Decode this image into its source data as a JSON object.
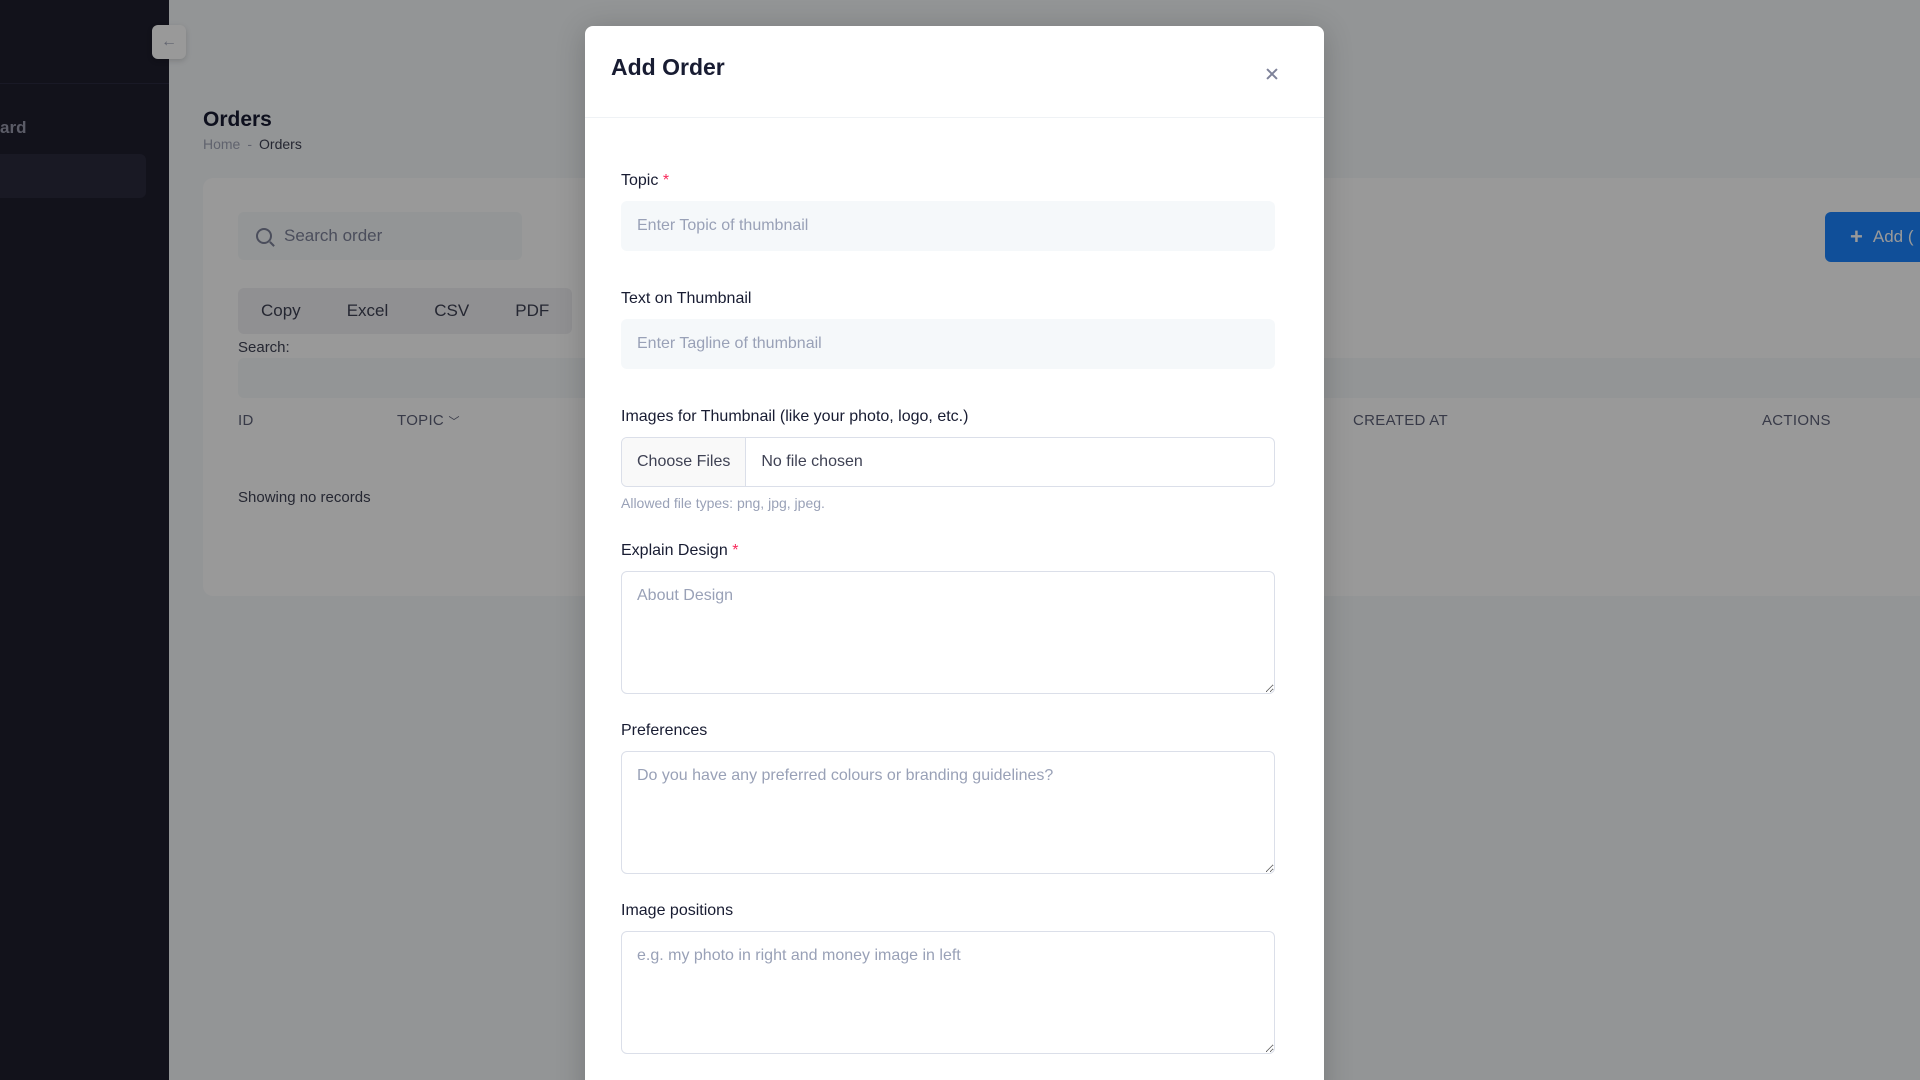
{
  "sidebar": {
    "item_label": "ard"
  },
  "page": {
    "title": "Orders",
    "breadcrumb": {
      "home": "Home",
      "separator": "-",
      "current": "Orders"
    }
  },
  "toolbar": {
    "search_placeholder": "Search order",
    "add_label": "Add ("
  },
  "exports": [
    "Copy",
    "Excel",
    "CSV",
    "PDF"
  ],
  "datatable": {
    "search_label": "Search:",
    "columns": {
      "id": "ID",
      "topic": "TOPIC",
      "created_at": "CREATED AT",
      "actions": "ACTIONS"
    },
    "empty_text": "Showing no records"
  },
  "modal": {
    "title": "Add Order",
    "topic": {
      "label": "Topic",
      "required": "*",
      "placeholder": "Enter Topic of thumbnail"
    },
    "text_on_thumbnail": {
      "label": "Text on Thumbnail",
      "placeholder": "Enter Tagline of thumbnail"
    },
    "images": {
      "label": "Images for Thumbnail (like your photo, logo, etc.)",
      "button": "Choose Files",
      "status": "No file chosen",
      "help": "Allowed file types: png, jpg, jpeg."
    },
    "explain_design": {
      "label": "Explain Design",
      "required": "*",
      "placeholder": "About Design"
    },
    "preferences": {
      "label": "Preferences",
      "placeholder": "Do you have any preferred colours or branding guidelines?"
    },
    "image_positions": {
      "label": "Image positions",
      "placeholder": "e.g. my photo in right and money image in left"
    }
  },
  "colors": {
    "primary": "#1b84ff",
    "required": "#f8285a",
    "sidebar": "#1e1e2d"
  }
}
